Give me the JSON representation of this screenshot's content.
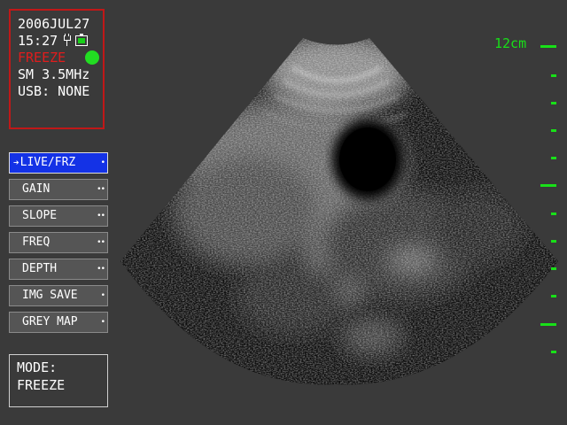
{
  "status": {
    "date": "2006JUL27",
    "time": "15:27",
    "state": "FREEZE",
    "probe": "SM 3.5MHz",
    "usb": "USB: NONE",
    "colors": {
      "border": "#c01818",
      "state": "#e01c1c",
      "indicator": "#22dd22"
    }
  },
  "menu": {
    "items": [
      {
        "label": "LIVE/FRZ",
        "active": true,
        "dots": "•"
      },
      {
        "label": "GAIN",
        "active": false,
        "dots": "••"
      },
      {
        "label": "SLOPE",
        "active": false,
        "dots": "••"
      },
      {
        "label": "FREQ",
        "active": false,
        "dots": "••"
      },
      {
        "label": "DEPTH",
        "active": false,
        "dots": "••"
      },
      {
        "label": "IMG SAVE",
        "active": false,
        "dots": "•"
      },
      {
        "label": "GREY MAP",
        "active": false,
        "dots": "•"
      }
    ],
    "active_color": "#1432e6"
  },
  "mode": {
    "label": "MODE:",
    "value": "FREEZE"
  },
  "depth_scale": {
    "label": "12cm",
    "max_cm": 12,
    "color": "#18e018"
  },
  "icons": {
    "power": "plug-icon",
    "battery": "battery-icon",
    "selected": "arrow-right-icon"
  }
}
